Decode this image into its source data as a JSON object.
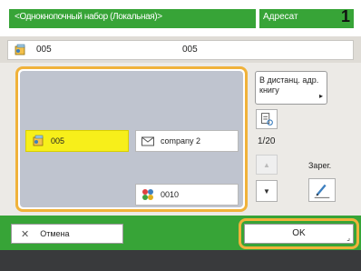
{
  "header": {
    "title": "<Однокнопочный набор (Локальная)>",
    "tab_label": "Адресат",
    "tab_count": "1"
  },
  "field": {
    "value_1": "005",
    "value_2": "005",
    "icon": "group-icon"
  },
  "list": {
    "items": [
      {
        "label": "005",
        "icon": "group-icon",
        "selected": true
      },
      {
        "label": "company 2",
        "icon": "email-icon",
        "selected": false
      },
      {
        "label": "0010",
        "icon": "multi-address-icon",
        "selected": false
      }
    ]
  },
  "controls": {
    "address_book_label": "В дистанц. адр. книгу",
    "address_book_arrow": "▸",
    "details_icon": "details-icon",
    "page_indicator": "1/20",
    "up_glyph": "▲",
    "down_glyph": "▼",
    "register_label": "Зарег.",
    "register_icon": "pen-icon"
  },
  "bottom": {
    "cancel_label": "Отмена",
    "cancel_glyph": "✕",
    "ok_label": "OK",
    "ok_corner": "⌟"
  },
  "colors": {
    "accent_green": "#37a437",
    "focus_orange": "#f0b23a",
    "selected_yellow": "#f7ef1a"
  }
}
